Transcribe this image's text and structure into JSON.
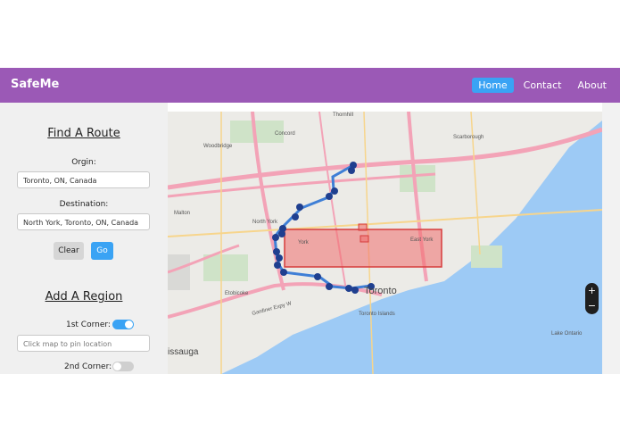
{
  "navbar": {
    "brand": "SafeMe",
    "items": [
      "Home",
      "Contact",
      "About"
    ],
    "active": "Home",
    "color": "#9b59b6",
    "accent": "#3aa3f4"
  },
  "route": {
    "title": "Find A Route",
    "origin_label": "Orgin:",
    "origin_value": "Toronto, ON, Canada",
    "destination_label": "Destination:",
    "destination_value": "North York, Toronto, ON, Canada",
    "clear_label": "Clear",
    "go_label": "Go"
  },
  "region": {
    "title": "Add A Region",
    "corner1_label": "1st Corner:",
    "corner1_on": true,
    "corner1_placeholder": "Click map to pin location",
    "corner2_label": "2nd Corner:",
    "corner2_on": false
  },
  "map": {
    "labels": [
      "Thornhill",
      "Concord",
      "Woodbridge",
      "Scarborough",
      "Malton",
      "Etobicoke",
      "Toronto",
      "Toronto Islands",
      "Lake Ontario",
      "issauga",
      "North York",
      "East York",
      "York",
      "Gardiner Expy W"
    ],
    "zoom_in": "+",
    "zoom_out": "−"
  }
}
